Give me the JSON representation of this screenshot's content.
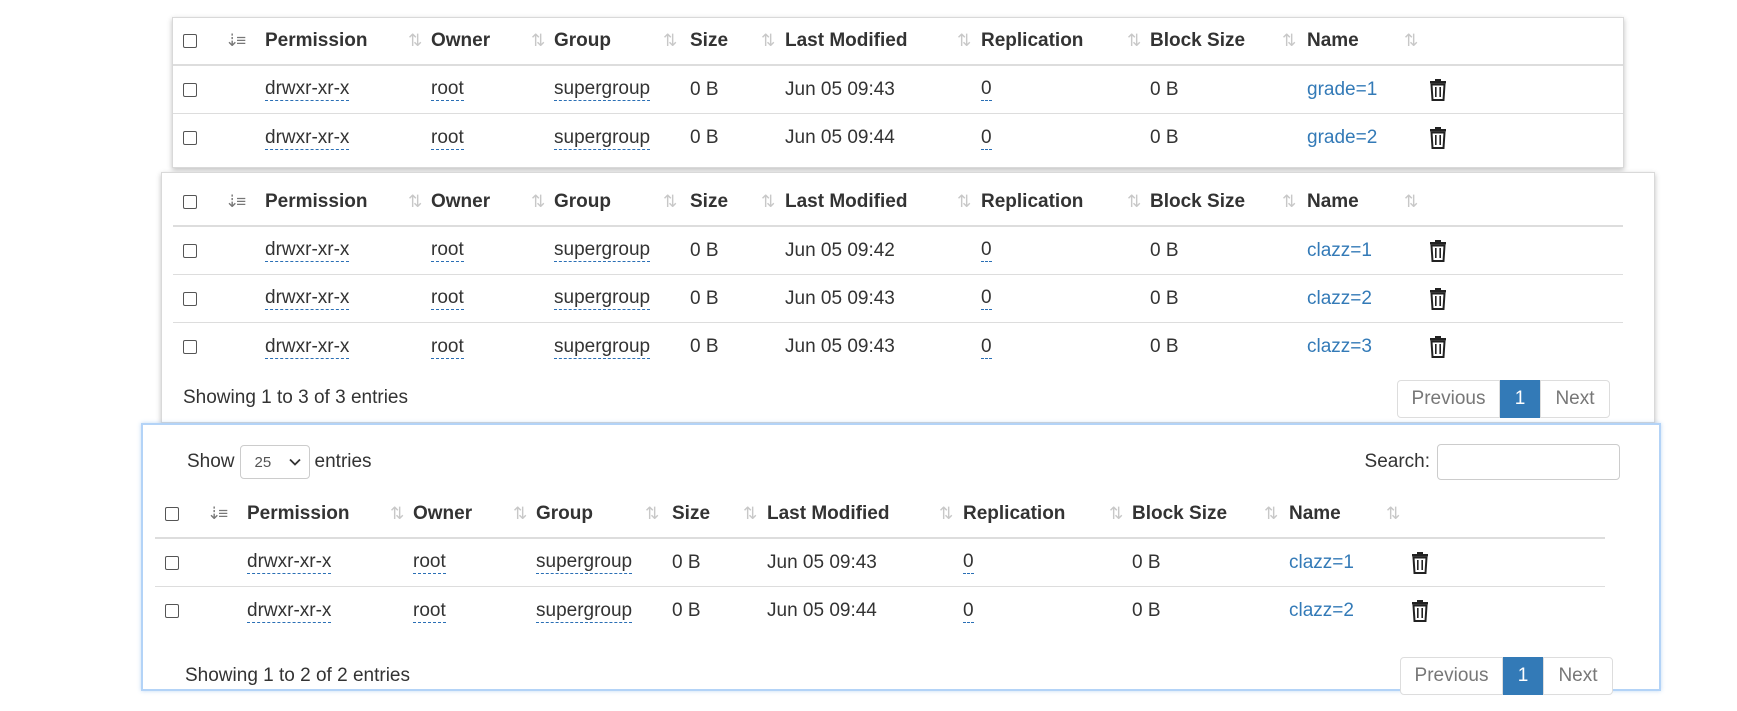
{
  "headers": {
    "permission": "Permission",
    "owner": "Owner",
    "group": "Group",
    "size": "Size",
    "last_modified": "Last Modified",
    "replication": "Replication",
    "block_size": "Block Size",
    "name": "Name"
  },
  "icons": {
    "sort_active": "sort-amount-down-icon",
    "sort_both": "sort-both-icon",
    "delete": "trash-icon",
    "chevron": "chevron-down-icon"
  },
  "colors": {
    "link": "#337ab7",
    "active_page": "#337ab7",
    "focus_border": "#b3d3f7"
  },
  "panel1": {
    "rows": [
      {
        "permission": "drwxr-xr-x",
        "owner": "root",
        "group": "supergroup",
        "size": "0 B",
        "last_modified": "Jun 05 09:43",
        "replication": "0",
        "block_size": "0 B",
        "name": "grade=1"
      },
      {
        "permission": "drwxr-xr-x",
        "owner": "root",
        "group": "supergroup",
        "size": "0 B",
        "last_modified": "Jun 05 09:44",
        "replication": "0",
        "block_size": "0 B",
        "name": "grade=2"
      }
    ]
  },
  "panel2": {
    "rows": [
      {
        "permission": "drwxr-xr-x",
        "owner": "root",
        "group": "supergroup",
        "size": "0 B",
        "last_modified": "Jun 05 09:42",
        "replication": "0",
        "block_size": "0 B",
        "name": "clazz=1"
      },
      {
        "permission": "drwxr-xr-x",
        "owner": "root",
        "group": "supergroup",
        "size": "0 B",
        "last_modified": "Jun 05 09:43",
        "replication": "0",
        "block_size": "0 B",
        "name": "clazz=2"
      },
      {
        "permission": "drwxr-xr-x",
        "owner": "root",
        "group": "supergroup",
        "size": "0 B",
        "last_modified": "Jun 05 09:43",
        "replication": "0",
        "block_size": "0 B",
        "name": "clazz=3"
      }
    ],
    "info": "Showing 1 to 3 of 3 entries",
    "pagination": {
      "previous": "Previous",
      "current": "1",
      "next": "Next"
    }
  },
  "panel3": {
    "length": {
      "show_label": "Show",
      "selected": "25",
      "entries_label": "entries"
    },
    "search": {
      "label": "Search:",
      "value": ""
    },
    "rows": [
      {
        "permission": "drwxr-xr-x",
        "owner": "root",
        "group": "supergroup",
        "size": "0 B",
        "last_modified": "Jun 05 09:43",
        "replication": "0",
        "block_size": "0 B",
        "name": "clazz=1"
      },
      {
        "permission": "drwxr-xr-x",
        "owner": "root",
        "group": "supergroup",
        "size": "0 B",
        "last_modified": "Jun 05 09:44",
        "replication": "0",
        "block_size": "0 B",
        "name": "clazz=2"
      }
    ],
    "info": "Showing 1 to 2 of 2 entries",
    "pagination": {
      "previous": "Previous",
      "current": "1",
      "next": "Next"
    }
  }
}
